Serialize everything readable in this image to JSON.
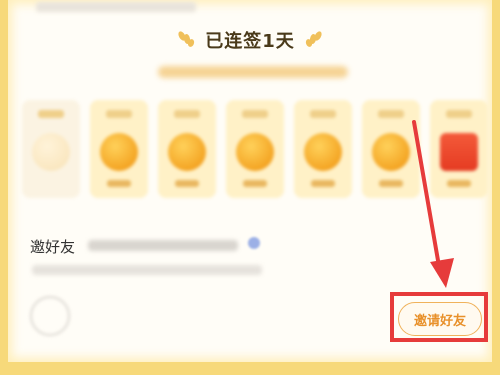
{
  "streak": {
    "title": "已连签1天"
  },
  "invite": {
    "title": "邀好友",
    "button_label": "邀请好友"
  },
  "colors": {
    "accent": "#e8902a",
    "highlight": "#e63b3b"
  },
  "days": [
    {
      "type": "coin",
      "claimed": true
    },
    {
      "type": "coin"
    },
    {
      "type": "coin"
    },
    {
      "type": "coin"
    },
    {
      "type": "coin"
    },
    {
      "type": "coin"
    },
    {
      "type": "gift"
    }
  ]
}
